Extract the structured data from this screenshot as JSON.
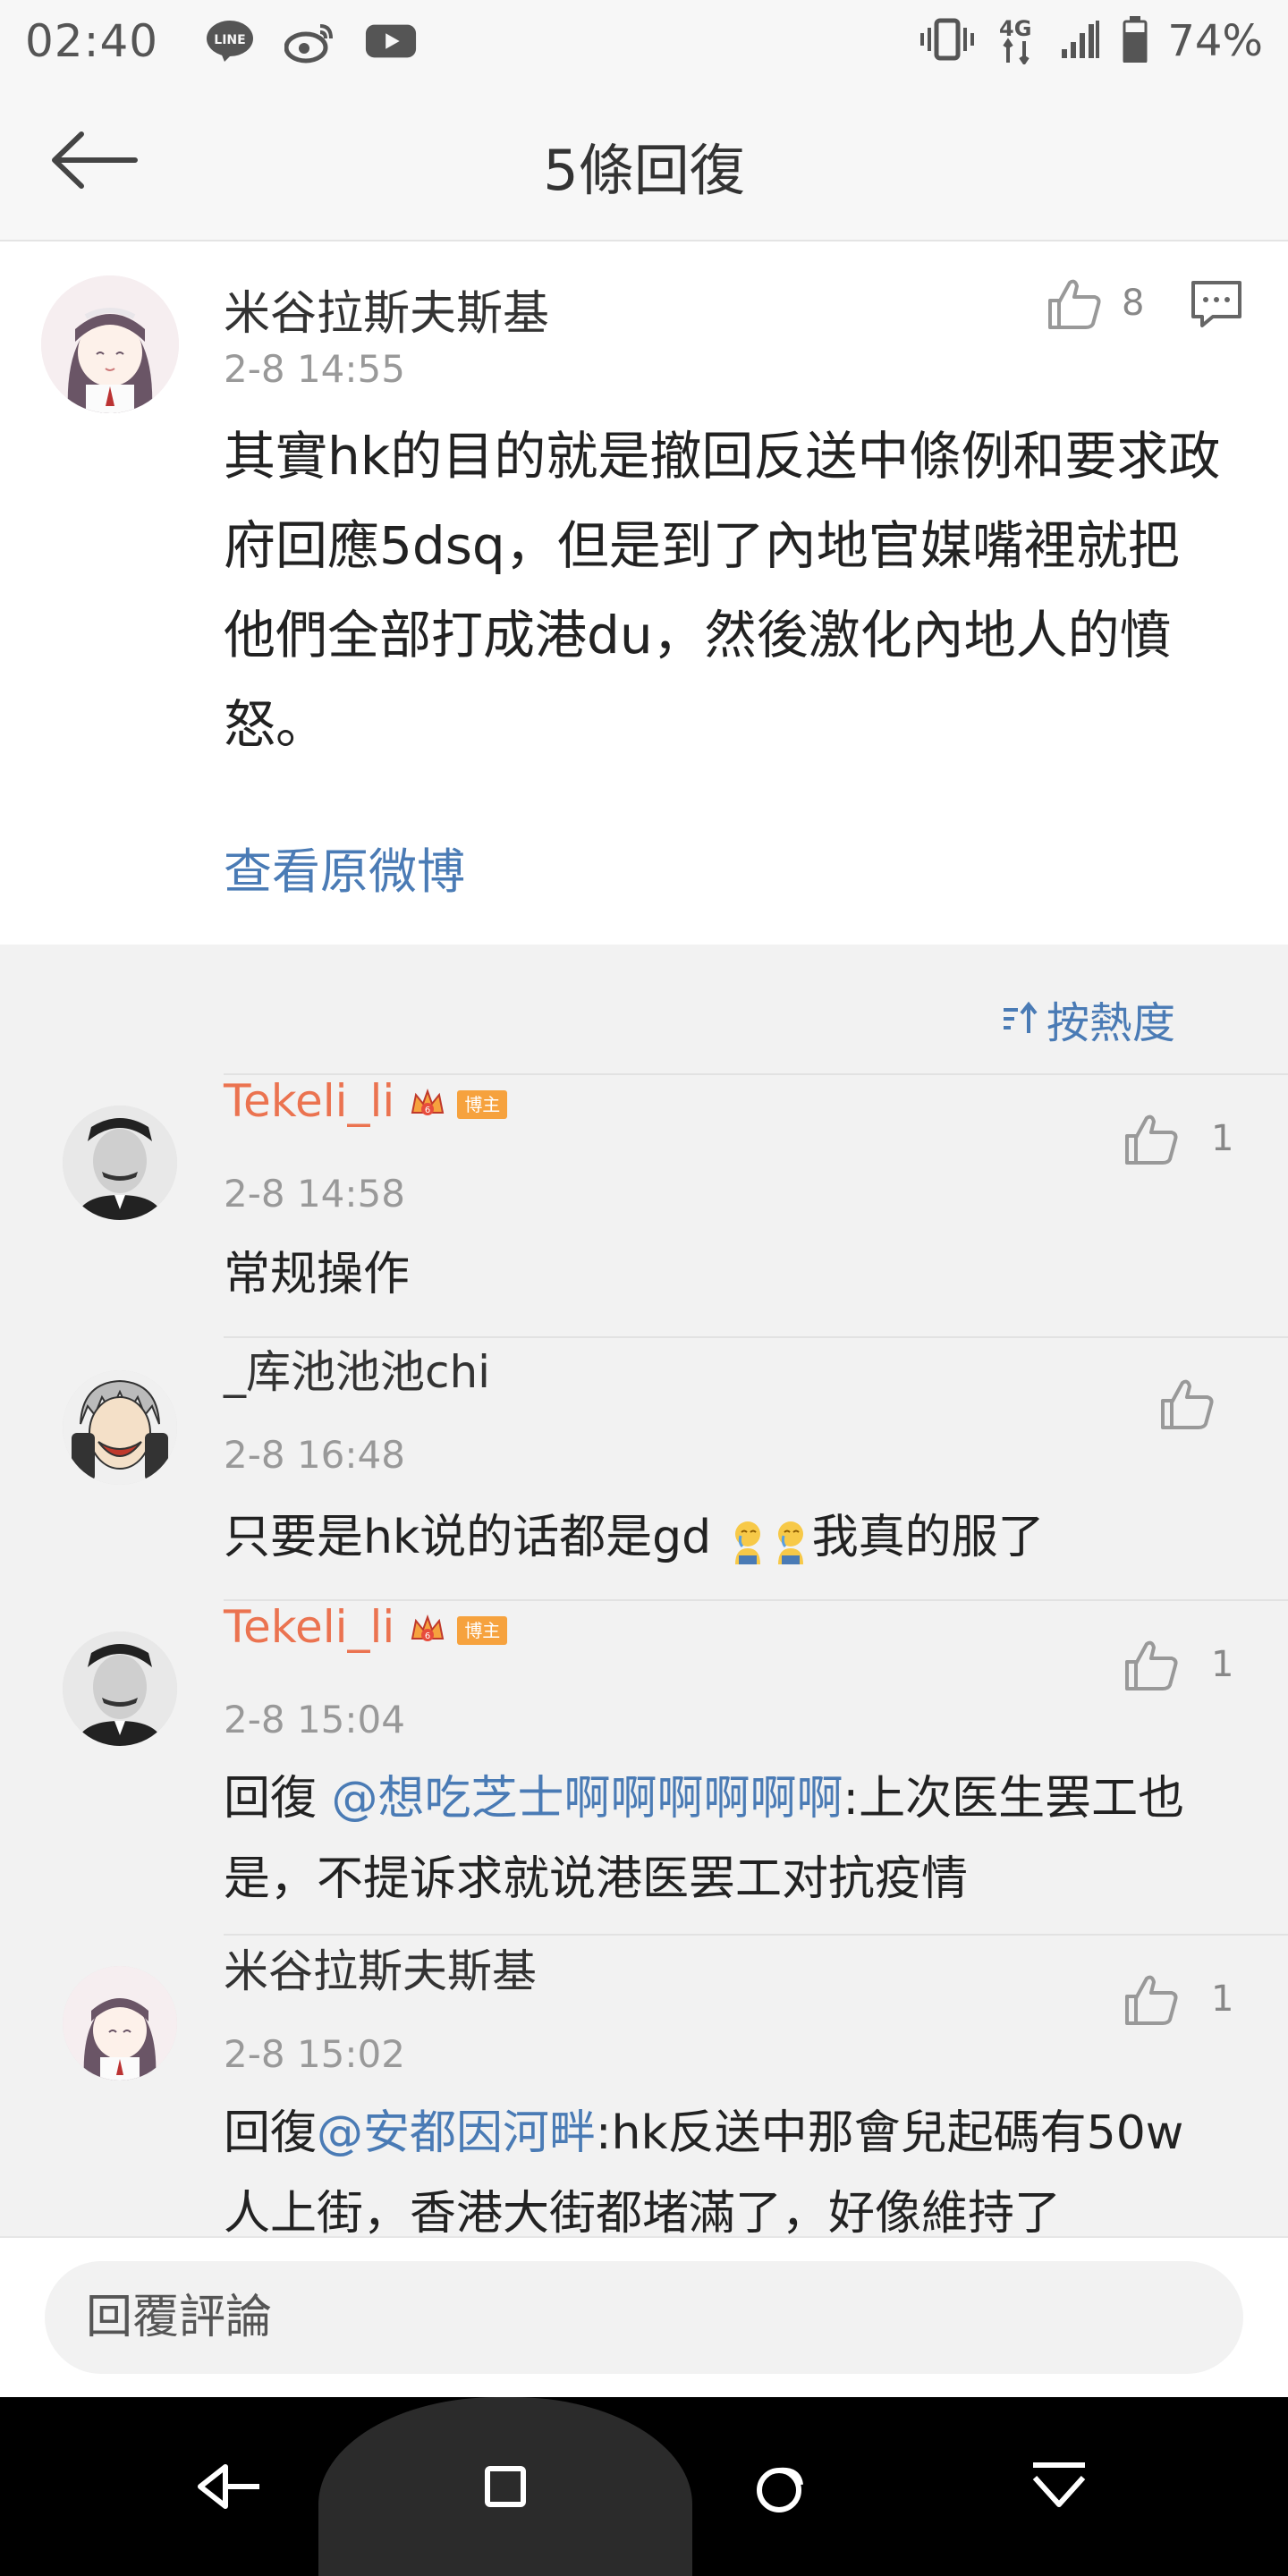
{
  "status_bar": {
    "time": "02:40",
    "battery_percent": "74%",
    "apps": [
      "line-icon",
      "weibo-icon",
      "youtube-icon"
    ],
    "network": "4G"
  },
  "header": {
    "title": "5條回復"
  },
  "post": {
    "author": "米谷拉斯夫斯基",
    "time": "2-8 14:55",
    "likes": "8",
    "content": "其實hk的目的就是撤回反送中條例和要求政府回應5dsq，但是到了內地官媒嘴裡就把他們全部打成港du，然後激化內地人的憤怒。",
    "view_original": "查看原微博"
  },
  "sort": {
    "label": "按熱度"
  },
  "replies": [
    {
      "author": "Tekeli_li",
      "badge": "博主",
      "time": "2-8 14:58",
      "likes": "1",
      "text": "常规操作"
    },
    {
      "author": "_库池池池chi",
      "time": "2-8 16:48",
      "likes": "",
      "text_before": "只要是hk说的话都是gd ",
      "text_after": "我真的服了"
    },
    {
      "author": "Tekeli_li",
      "badge": "博主",
      "time": "2-8 15:04",
      "likes": "1",
      "prefix": "回復 ",
      "mention": "@想吃芝士啊啊啊啊啊啊",
      "text": ":上次医生罢工也是，不提诉求就说港医罢工对抗疫情"
    },
    {
      "author": "米谷拉斯夫斯基",
      "time": "2-8 15:02",
      "likes": "1",
      "prefix": "回復",
      "mention": "@安都因河畔",
      "text": ":hk反送中那會兒起碼有50w人上街，香港大街都堵滿了，好像維持了"
    }
  ],
  "input": {
    "placeholder": "回覆評論"
  },
  "colors": {
    "link": "#4a7bb5",
    "author_highlight": "#eb7350",
    "badge": "#f6a23e"
  }
}
